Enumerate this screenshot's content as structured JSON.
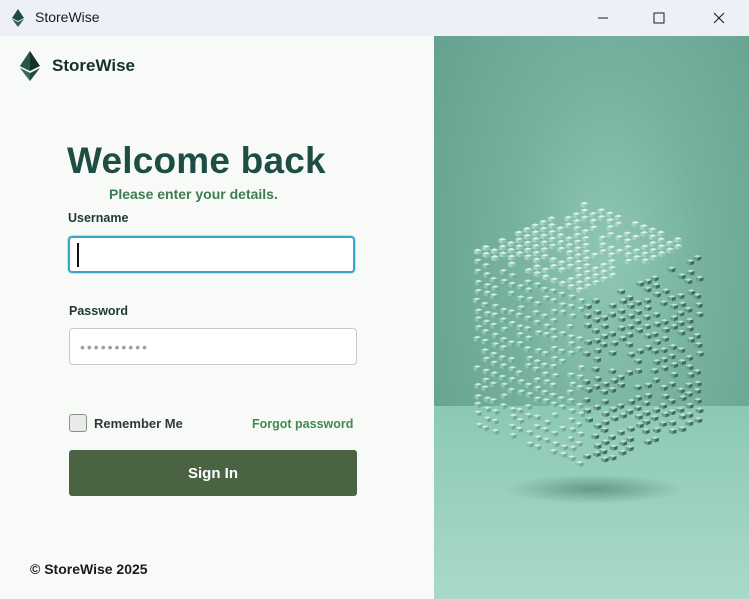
{
  "window": {
    "title": "StoreWise",
    "app_icon": "ethereum-diamond-icon",
    "controls": [
      "minimize-icon",
      "maximize-icon",
      "close-icon"
    ]
  },
  "brand": {
    "name": "StoreWise",
    "logo_icon": "ethereum-diamond-icon"
  },
  "login": {
    "heading": "Welcome back",
    "subheading": "Please enter your details.",
    "username_label": "Username",
    "username_value": "",
    "password_label": "Password",
    "password_value": "••••••••••",
    "remember_label": "Remember Me",
    "remember_checked": false,
    "forgot_label": "Forgot password",
    "signin_label": "Sign In"
  },
  "footer": {
    "copyright": "© StoreWise 2025"
  },
  "hero": {
    "image": "voxel-cube-illustration"
  },
  "colors": {
    "heading": "#1d4d45",
    "subheading": "#3e7a52",
    "accent_link": "#3f8a4c",
    "button": "#4a6343",
    "focus_border": "#3aa4c8",
    "hero_bg": "#75b19e"
  }
}
